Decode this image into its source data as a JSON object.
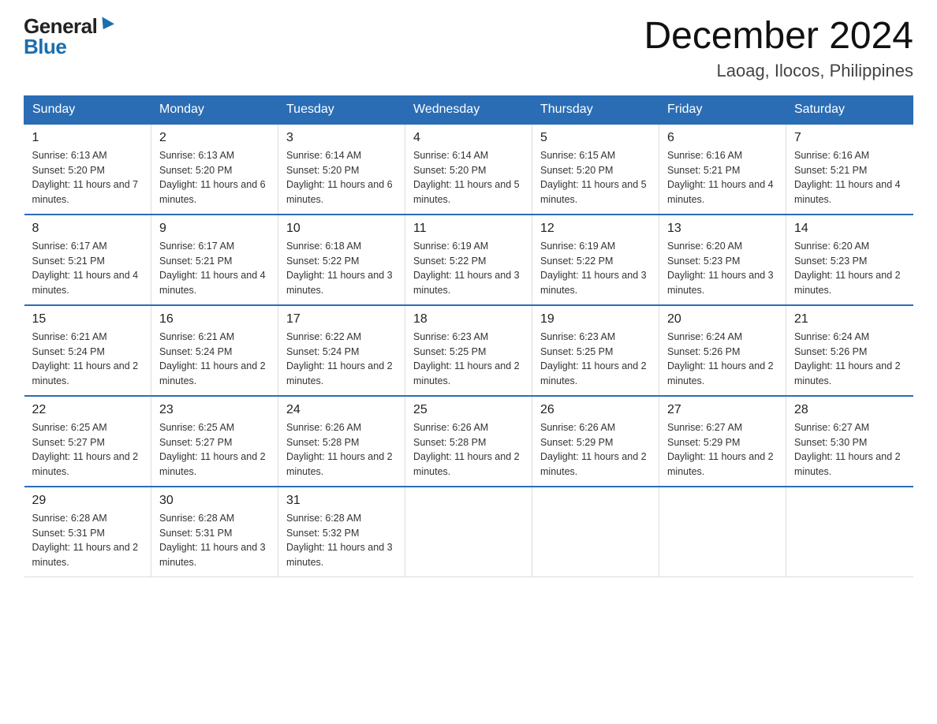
{
  "header": {
    "logo_general": "General",
    "logo_blue": "Blue",
    "month_year": "December 2024",
    "location": "Laoag, Ilocos, Philippines"
  },
  "days_of_week": [
    "Sunday",
    "Monday",
    "Tuesday",
    "Wednesday",
    "Thursday",
    "Friday",
    "Saturday"
  ],
  "weeks": [
    [
      {
        "day": "1",
        "sunrise": "6:13 AM",
        "sunset": "5:20 PM",
        "daylight": "11 hours and 7 minutes."
      },
      {
        "day": "2",
        "sunrise": "6:13 AM",
        "sunset": "5:20 PM",
        "daylight": "11 hours and 6 minutes."
      },
      {
        "day": "3",
        "sunrise": "6:14 AM",
        "sunset": "5:20 PM",
        "daylight": "11 hours and 6 minutes."
      },
      {
        "day": "4",
        "sunrise": "6:14 AM",
        "sunset": "5:20 PM",
        "daylight": "11 hours and 5 minutes."
      },
      {
        "day": "5",
        "sunrise": "6:15 AM",
        "sunset": "5:20 PM",
        "daylight": "11 hours and 5 minutes."
      },
      {
        "day": "6",
        "sunrise": "6:16 AM",
        "sunset": "5:21 PM",
        "daylight": "11 hours and 4 minutes."
      },
      {
        "day": "7",
        "sunrise": "6:16 AM",
        "sunset": "5:21 PM",
        "daylight": "11 hours and 4 minutes."
      }
    ],
    [
      {
        "day": "8",
        "sunrise": "6:17 AM",
        "sunset": "5:21 PM",
        "daylight": "11 hours and 4 minutes."
      },
      {
        "day": "9",
        "sunrise": "6:17 AM",
        "sunset": "5:21 PM",
        "daylight": "11 hours and 4 minutes."
      },
      {
        "day": "10",
        "sunrise": "6:18 AM",
        "sunset": "5:22 PM",
        "daylight": "11 hours and 3 minutes."
      },
      {
        "day": "11",
        "sunrise": "6:19 AM",
        "sunset": "5:22 PM",
        "daylight": "11 hours and 3 minutes."
      },
      {
        "day": "12",
        "sunrise": "6:19 AM",
        "sunset": "5:22 PM",
        "daylight": "11 hours and 3 minutes."
      },
      {
        "day": "13",
        "sunrise": "6:20 AM",
        "sunset": "5:23 PM",
        "daylight": "11 hours and 3 minutes."
      },
      {
        "day": "14",
        "sunrise": "6:20 AM",
        "sunset": "5:23 PM",
        "daylight": "11 hours and 2 minutes."
      }
    ],
    [
      {
        "day": "15",
        "sunrise": "6:21 AM",
        "sunset": "5:24 PM",
        "daylight": "11 hours and 2 minutes."
      },
      {
        "day": "16",
        "sunrise": "6:21 AM",
        "sunset": "5:24 PM",
        "daylight": "11 hours and 2 minutes."
      },
      {
        "day": "17",
        "sunrise": "6:22 AM",
        "sunset": "5:24 PM",
        "daylight": "11 hours and 2 minutes."
      },
      {
        "day": "18",
        "sunrise": "6:23 AM",
        "sunset": "5:25 PM",
        "daylight": "11 hours and 2 minutes."
      },
      {
        "day": "19",
        "sunrise": "6:23 AM",
        "sunset": "5:25 PM",
        "daylight": "11 hours and 2 minutes."
      },
      {
        "day": "20",
        "sunrise": "6:24 AM",
        "sunset": "5:26 PM",
        "daylight": "11 hours and 2 minutes."
      },
      {
        "day": "21",
        "sunrise": "6:24 AM",
        "sunset": "5:26 PM",
        "daylight": "11 hours and 2 minutes."
      }
    ],
    [
      {
        "day": "22",
        "sunrise": "6:25 AM",
        "sunset": "5:27 PM",
        "daylight": "11 hours and 2 minutes."
      },
      {
        "day": "23",
        "sunrise": "6:25 AM",
        "sunset": "5:27 PM",
        "daylight": "11 hours and 2 minutes."
      },
      {
        "day": "24",
        "sunrise": "6:26 AM",
        "sunset": "5:28 PM",
        "daylight": "11 hours and 2 minutes."
      },
      {
        "day": "25",
        "sunrise": "6:26 AM",
        "sunset": "5:28 PM",
        "daylight": "11 hours and 2 minutes."
      },
      {
        "day": "26",
        "sunrise": "6:26 AM",
        "sunset": "5:29 PM",
        "daylight": "11 hours and 2 minutes."
      },
      {
        "day": "27",
        "sunrise": "6:27 AM",
        "sunset": "5:29 PM",
        "daylight": "11 hours and 2 minutes."
      },
      {
        "day": "28",
        "sunrise": "6:27 AM",
        "sunset": "5:30 PM",
        "daylight": "11 hours and 2 minutes."
      }
    ],
    [
      {
        "day": "29",
        "sunrise": "6:28 AM",
        "sunset": "5:31 PM",
        "daylight": "11 hours and 2 minutes."
      },
      {
        "day": "30",
        "sunrise": "6:28 AM",
        "sunset": "5:31 PM",
        "daylight": "11 hours and 3 minutes."
      },
      {
        "day": "31",
        "sunrise": "6:28 AM",
        "sunset": "5:32 PM",
        "daylight": "11 hours and 3 minutes."
      },
      null,
      null,
      null,
      null
    ]
  ]
}
